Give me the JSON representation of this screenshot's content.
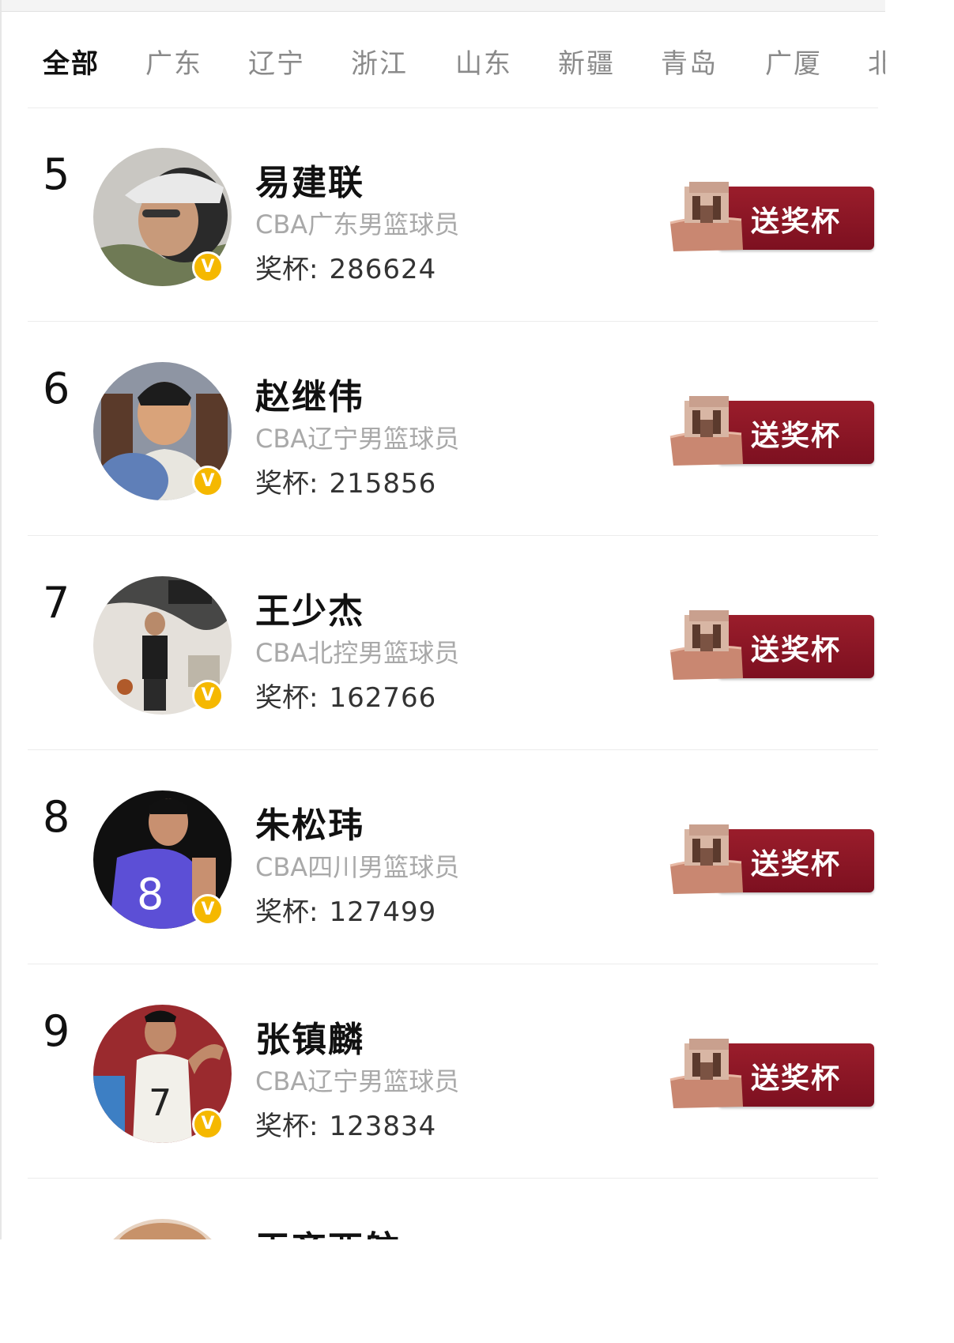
{
  "tabs": [
    {
      "label": "全部",
      "active": true
    },
    {
      "label": "广东",
      "active": false
    },
    {
      "label": "辽宁",
      "active": false
    },
    {
      "label": "浙江",
      "active": false
    },
    {
      "label": "山东",
      "active": false
    },
    {
      "label": "新疆",
      "active": false
    },
    {
      "label": "青岛",
      "active": false
    },
    {
      "label": "广厦",
      "active": false
    },
    {
      "label": "北",
      "active": false
    }
  ],
  "players": [
    {
      "rank": "5",
      "name": "易建联",
      "desc": "CBA广东男篮球员",
      "trophy_label": "奖杯:",
      "trophy_count": "286624",
      "button": "送奖杯",
      "verified": "V"
    },
    {
      "rank": "6",
      "name": "赵继伟",
      "desc": "CBA辽宁男篮球员",
      "trophy_label": "奖杯:",
      "trophy_count": "215856",
      "button": "送奖杯",
      "verified": "V"
    },
    {
      "rank": "7",
      "name": "王少杰",
      "desc": "CBA北控男篮球员",
      "trophy_label": "奖杯:",
      "trophy_count": "162766",
      "button": "送奖杯",
      "verified": "V"
    },
    {
      "rank": "8",
      "name": "朱松玮",
      "desc": "CBA四川男篮球员",
      "trophy_label": "奖杯:",
      "trophy_count": "127499",
      "button": "送奖杯",
      "verified": "V"
    },
    {
      "rank": "9",
      "name": "张镇麟",
      "desc": "CBA辽宁男篮球员",
      "trophy_label": "奖杯:",
      "trophy_count": "123834",
      "button": "送奖杯",
      "verified": "V"
    }
  ],
  "next_player_partial": {
    "name": "王齐西航"
  },
  "colors": {
    "accent_red": "#8b1626",
    "badge_gold": "#f5b800",
    "muted_text": "#a9a9a9"
  }
}
